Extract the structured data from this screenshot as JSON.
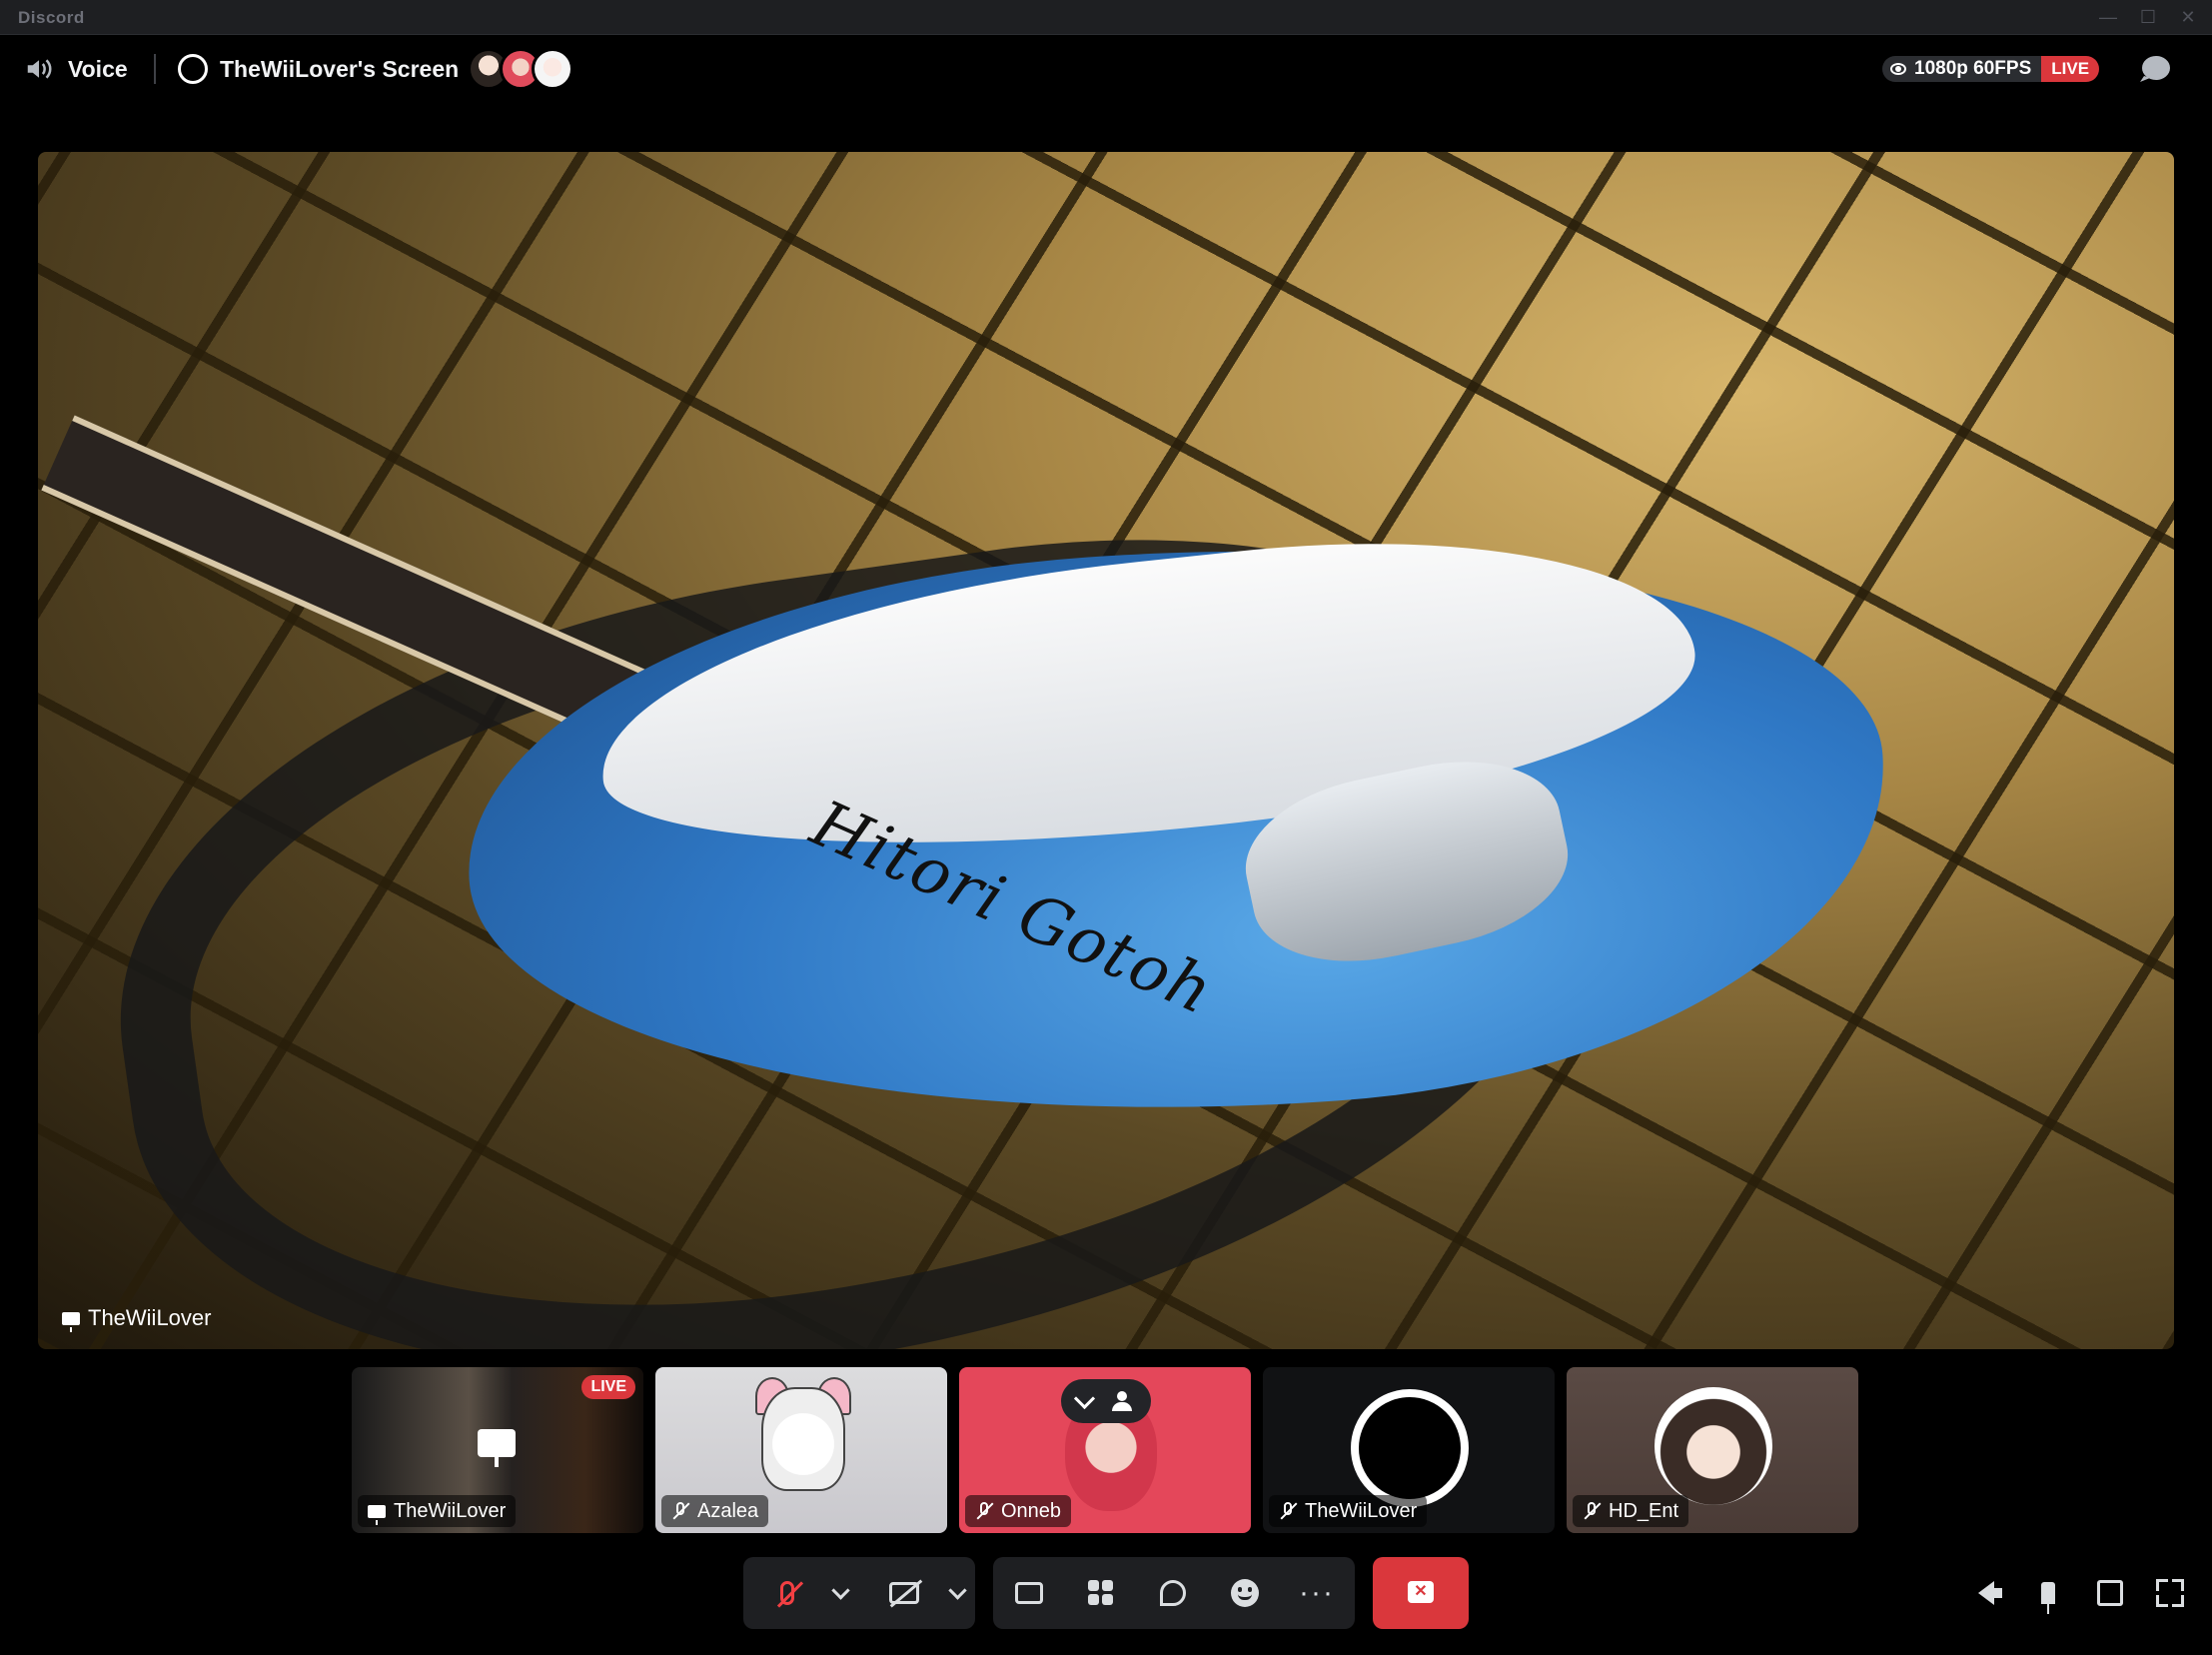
{
  "window": {
    "app_name": "Discord"
  },
  "header": {
    "voice_label": "Voice",
    "screen_title": "TheWiiLover's Screen",
    "quality_label": "1080p 60FPS",
    "live_label": "LIVE"
  },
  "stream": {
    "streamer_name": "TheWiiLover",
    "guitar_signature": "Hitori Gotoh"
  },
  "participants": [
    {
      "name": "TheWiiLover",
      "live_label": "LIVE",
      "type": "stream"
    },
    {
      "name": "Azalea",
      "muted": true
    },
    {
      "name": "Onneb",
      "muted": true
    },
    {
      "name": "TheWiiLover",
      "muted": true
    },
    {
      "name": "HD_Ent",
      "muted": true
    }
  ],
  "controls": {
    "more_label": "···"
  },
  "colors": {
    "background": "#000000",
    "live_red": "#da373c",
    "control_bg": "#1e1f22",
    "onneb_tile": "#e4475a"
  }
}
